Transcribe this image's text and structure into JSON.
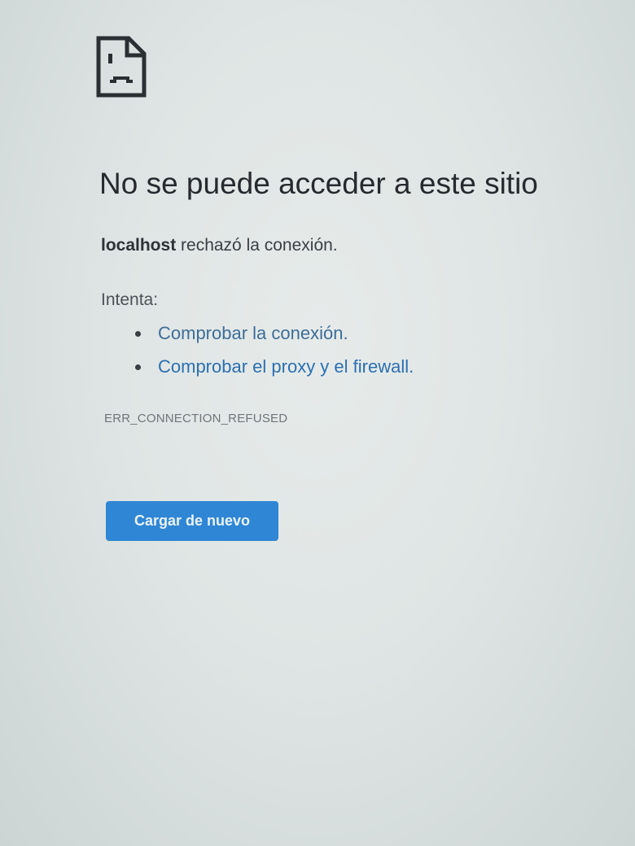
{
  "icon": "sad-document-icon",
  "title": "No se puede acceder a este sitio",
  "message": {
    "host": "localhost",
    "text": " rechazó la conexión."
  },
  "suggestions": {
    "label": "Intenta:",
    "items": [
      {
        "text": "Comprobar la conexión."
      },
      {
        "text": "Comprobar el proxy y el firewall."
      }
    ]
  },
  "error_code": "ERR_CONNECTION_REFUSED",
  "reload_button": "Cargar de nuevo",
  "colors": {
    "accent": "#2f86d4",
    "link": "#2c6fb0"
  }
}
